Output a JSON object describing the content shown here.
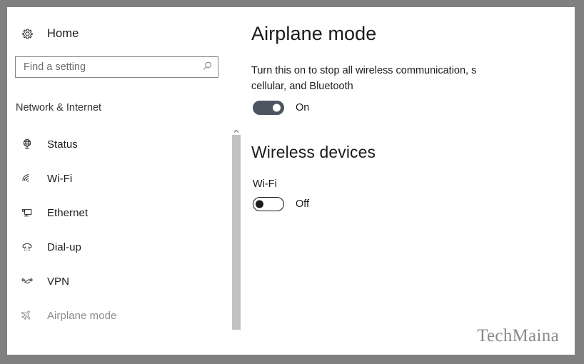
{
  "window": {
    "home_label": "Home",
    "home_icon": "gear-icon"
  },
  "search": {
    "placeholder": "Find a setting",
    "value": "",
    "icon": "search-icon"
  },
  "sidebar": {
    "category": "Network & Internet",
    "items": [
      {
        "label": "Status",
        "icon": "globe-monitor-icon",
        "active": false
      },
      {
        "label": "Wi-Fi",
        "icon": "wifi-icon",
        "active": false
      },
      {
        "label": "Ethernet",
        "icon": "ethernet-icon",
        "active": false
      },
      {
        "label": "Dial-up",
        "icon": "dialup-phone-icon",
        "active": false
      },
      {
        "label": "VPN",
        "icon": "vpn-icon",
        "active": false
      },
      {
        "label": "Airplane mode",
        "icon": "airplane-icon",
        "active": true
      }
    ]
  },
  "scrollbar": {
    "up_arrow_icon": "chevron-up-icon"
  },
  "main": {
    "title": "Airplane mode",
    "description": "Turn this on to stop all wireless communication, s\ncellular, and Bluetooth",
    "airplane_toggle": {
      "state_label": "On",
      "checked": true
    },
    "section_heading": "Wireless devices",
    "device_label": "Wi-Fi",
    "wifi_toggle": {
      "state_label": "Off",
      "checked": false
    }
  },
  "watermark": {
    "text": "TechMaina"
  },
  "colors": {
    "frame": "#808080",
    "toggle_on": "#4c5560",
    "toggle_off_border": "#1b1b1b",
    "scroll_thumb": "#c1c1c1",
    "active_nav_text": "#8c8c8c",
    "watermark": "#8a8a8a"
  }
}
